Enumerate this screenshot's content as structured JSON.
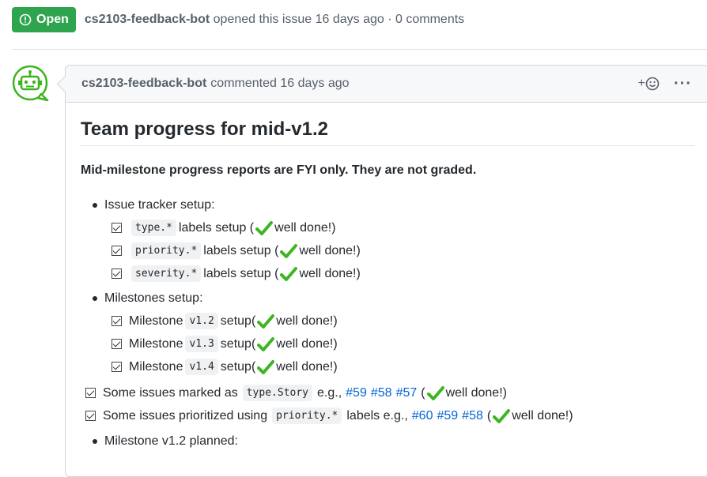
{
  "header": {
    "state": "Open",
    "author": "cs2103-feedback-bot",
    "action": "opened this issue 16 days ago · 0 comments"
  },
  "comment": {
    "author": "cs2103-feedback-bot",
    "action": "commented 16 days ago",
    "react_label": "+",
    "more_label": "···",
    "title": "Team progress for mid-v1.2",
    "note": "Mid-milestone progress reports are FYI only. They are not graded.",
    "issue_tracker": {
      "label": "Issue tracker setup:",
      "items": [
        {
          "code": "type.*",
          "text": "labels setup (",
          "done": "well done!)"
        },
        {
          "code": "priority.*",
          "text": "labels setup (",
          "done": "well done!)"
        },
        {
          "code": "severity.*",
          "text": "labels setup (",
          "done": "well done!)"
        }
      ]
    },
    "milestones": {
      "label": "Milestones setup:",
      "items": [
        {
          "pre": "Milestone",
          "code": "v1.2",
          "text": "setup(",
          "done": "well done!)"
        },
        {
          "pre": "Milestone",
          "code": "v1.3",
          "text": "setup(",
          "done": "well done!)"
        },
        {
          "pre": "Milestone",
          "code": "v1.4",
          "text": "setup(",
          "done": "well done!)"
        }
      ]
    },
    "story_task": {
      "pre": "Some issues marked as",
      "code": "type.Story",
      "mid": "e.g.,",
      "links": [
        "#59",
        "#58",
        "#57"
      ],
      "post": "(",
      "done": "well done!)"
    },
    "priority_task": {
      "pre": "Some issues prioritized using",
      "code": "priority.*",
      "mid": "labels e.g.,",
      "links": [
        "#60",
        "#59",
        "#58"
      ],
      "post": "(",
      "done": "well done!)"
    },
    "planned": "Milestone v1.2 planned:"
  },
  "colors": {
    "open_green": "#2ea44f",
    "check_green": "#3cb521",
    "link_blue": "#0366d6"
  }
}
